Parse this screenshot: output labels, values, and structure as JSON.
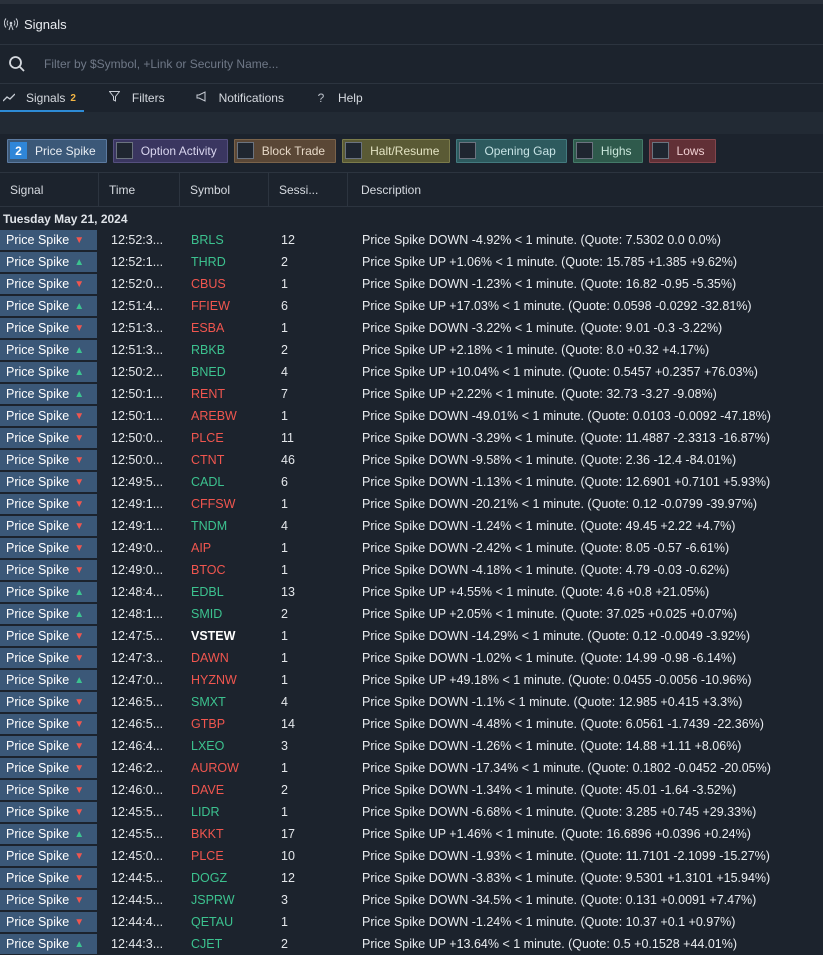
{
  "window": {
    "title": "Signals",
    "title_icon": "broadcast-icon"
  },
  "search": {
    "placeholder": "Filter by $Symbol, +Link or Security Name..."
  },
  "tabs": [
    {
      "label": "Signals",
      "badge": "2",
      "icon": "chart-line-icon"
    },
    {
      "label": "Filters",
      "icon": "funnel-icon"
    },
    {
      "label": "Notifications",
      "icon": "megaphone-icon"
    },
    {
      "label": "Help",
      "icon": "question-icon"
    }
  ],
  "chips": [
    {
      "label": "Price Spike",
      "badge": "2",
      "bg": "#3b5878",
      "border": "#5c7aa0",
      "text": "#e8edf3"
    },
    {
      "label": "Option Activity",
      "bg": "#3a3660",
      "border": "#55507f",
      "text": "#d9d6ef"
    },
    {
      "label": "Block Trade",
      "bg": "#5a4736",
      "border": "#7a634b",
      "text": "#e6d8c7"
    },
    {
      "label": "Halt/Resume",
      "bg": "#5a5a35",
      "border": "#7b7b4b",
      "text": "#e3e3c2"
    },
    {
      "label": "Opening Gap",
      "bg": "#2d5a5e",
      "border": "#437a7f",
      "text": "#c7e3e5"
    },
    {
      "label": "Highs",
      "bg": "#2f5a4c",
      "border": "#447a69",
      "text": "#c9e6da"
    },
    {
      "label": "Lows",
      "bg": "#613036",
      "border": "#83464d",
      "text": "#f0cfd2"
    }
  ],
  "columns": {
    "signal": "Signal",
    "time": "Time",
    "symbol": "Symbol",
    "session": "Sessi...",
    "description": "Description"
  },
  "date_group": "Tuesday May 21, 2024",
  "rows": [
    {
      "signal": "Price Spike",
      "dir": "down",
      "time": "12:52:3...",
      "symbol": "BRLS",
      "sym_color": "up",
      "session": "12",
      "desc": "Price Spike DOWN -4.92% < 1 minute. (Quote: 7.5302 0.0 0.0%)"
    },
    {
      "signal": "Price Spike",
      "dir": "up",
      "time": "12:52:1...",
      "symbol": "THRD",
      "sym_color": "up",
      "session": "2",
      "desc": "Price Spike UP +1.06% < 1 minute. (Quote: 15.785 +1.385 +9.62%)"
    },
    {
      "signal": "Price Spike",
      "dir": "down",
      "time": "12:52:0...",
      "symbol": "CBUS",
      "sym_color": "down",
      "session": "1",
      "desc": "Price Spike DOWN -1.23% < 1 minute. (Quote: 16.82 -0.95 -5.35%)"
    },
    {
      "signal": "Price Spike",
      "dir": "up",
      "time": "12:51:4...",
      "symbol": "FFIEW",
      "sym_color": "down",
      "session": "6",
      "desc": "Price Spike UP +17.03% < 1 minute. (Quote: 0.0598 -0.0292 -32.81%)"
    },
    {
      "signal": "Price Spike",
      "dir": "down",
      "time": "12:51:3...",
      "symbol": "ESBA",
      "sym_color": "down",
      "session": "1",
      "desc": "Price Spike DOWN -3.22% < 1 minute. (Quote: 9.01 -0.3 -3.22%)"
    },
    {
      "signal": "Price Spike",
      "dir": "up",
      "time": "12:51:3...",
      "symbol": "RBKB",
      "sym_color": "up",
      "session": "2",
      "desc": "Price Spike UP +2.18% < 1 minute. (Quote: 8.0 +0.32 +4.17%)"
    },
    {
      "signal": "Price Spike",
      "dir": "up",
      "time": "12:50:2...",
      "symbol": "BNED",
      "sym_color": "up",
      "session": "4",
      "desc": "Price Spike UP +10.04% < 1 minute. (Quote: 0.5457 +0.2357 +76.03%)"
    },
    {
      "signal": "Price Spike",
      "dir": "up",
      "time": "12:50:1...",
      "symbol": "RENT",
      "sym_color": "down",
      "session": "7",
      "desc": "Price Spike UP +2.22% < 1 minute. (Quote: 32.73 -3.27 -9.08%)"
    },
    {
      "signal": "Price Spike",
      "dir": "down",
      "time": "12:50:1...",
      "symbol": "AREBW",
      "sym_color": "down",
      "session": "1",
      "desc": "Price Spike DOWN -49.01% < 1 minute. (Quote: 0.0103 -0.0092 -47.18%)"
    },
    {
      "signal": "Price Spike",
      "dir": "down",
      "time": "12:50:0...",
      "symbol": "PLCE",
      "sym_color": "down",
      "session": "11",
      "desc": "Price Spike DOWN -3.29% < 1 minute. (Quote: 11.4887 -2.3313 -16.87%)"
    },
    {
      "signal": "Price Spike",
      "dir": "down",
      "time": "12:50:0...",
      "symbol": "CTNT",
      "sym_color": "down",
      "session": "46",
      "desc": "Price Spike DOWN -9.58% < 1 minute. (Quote: 2.36 -12.4 -84.01%)"
    },
    {
      "signal": "Price Spike",
      "dir": "down",
      "time": "12:49:5...",
      "symbol": "CADL",
      "sym_color": "up",
      "session": "6",
      "desc": "Price Spike DOWN -1.13% < 1 minute. (Quote: 12.6901 +0.7101 +5.93%)"
    },
    {
      "signal": "Price Spike",
      "dir": "down",
      "time": "12:49:1...",
      "symbol": "CFFSW",
      "sym_color": "down",
      "session": "1",
      "desc": "Price Spike DOWN -20.21% < 1 minute. (Quote: 0.12 -0.0799 -39.97%)"
    },
    {
      "signal": "Price Spike",
      "dir": "down",
      "time": "12:49:1...",
      "symbol": "TNDM",
      "sym_color": "up",
      "session": "4",
      "desc": "Price Spike DOWN -1.24% < 1 minute. (Quote: 49.45 +2.22 +4.7%)"
    },
    {
      "signal": "Price Spike",
      "dir": "down",
      "time": "12:49:0...",
      "symbol": "AIP",
      "sym_color": "down",
      "session": "1",
      "desc": "Price Spike DOWN -2.42% < 1 minute. (Quote: 8.05 -0.57 -6.61%)"
    },
    {
      "signal": "Price Spike",
      "dir": "down",
      "time": "12:49:0...",
      "symbol": "BTOC",
      "sym_color": "down",
      "session": "1",
      "desc": "Price Spike DOWN -4.18% < 1 minute. (Quote: 4.79 -0.03 -0.62%)"
    },
    {
      "signal": "Price Spike",
      "dir": "up",
      "time": "12:48:4...",
      "symbol": "EDBL",
      "sym_color": "up",
      "session": "13",
      "desc": "Price Spike UP +4.55% < 1 minute. (Quote: 4.6 +0.8 +21.05%)"
    },
    {
      "signal": "Price Spike",
      "dir": "up",
      "time": "12:48:1...",
      "symbol": "SMID",
      "sym_color": "up",
      "session": "2",
      "desc": "Price Spike UP +2.05% < 1 minute. (Quote: 37.025 +0.025 +0.07%)"
    },
    {
      "signal": "Price Spike",
      "dir": "down",
      "time": "12:47:5...",
      "symbol": "VSTEW",
      "sym_color": "white",
      "session": "1",
      "desc": "Price Spike DOWN -14.29% < 1 minute. (Quote: 0.12 -0.0049 -3.92%)"
    },
    {
      "signal": "Price Spike",
      "dir": "down",
      "time": "12:47:3...",
      "symbol": "DAWN",
      "sym_color": "down",
      "session": "1",
      "desc": "Price Spike DOWN -1.02% < 1 minute. (Quote: 14.99 -0.98 -6.14%)"
    },
    {
      "signal": "Price Spike",
      "dir": "up",
      "time": "12:47:0...",
      "symbol": "HYZNW",
      "sym_color": "down",
      "session": "1",
      "desc": "Price Spike UP +49.18% < 1 minute. (Quote: 0.0455 -0.0056 -10.96%)"
    },
    {
      "signal": "Price Spike",
      "dir": "down",
      "time": "12:46:5...",
      "symbol": "SMXT",
      "sym_color": "up",
      "session": "4",
      "desc": "Price Spike DOWN -1.1% < 1 minute. (Quote: 12.985 +0.415 +3.3%)"
    },
    {
      "signal": "Price Spike",
      "dir": "down",
      "time": "12:46:5...",
      "symbol": "GTBP",
      "sym_color": "down",
      "session": "14",
      "desc": "Price Spike DOWN -4.48% < 1 minute. (Quote: 6.0561 -1.7439 -22.36%)"
    },
    {
      "signal": "Price Spike",
      "dir": "down",
      "time": "12:46:4...",
      "symbol": "LXEO",
      "sym_color": "up",
      "session": "3",
      "desc": "Price Spike DOWN -1.26% < 1 minute. (Quote: 14.88 +1.11 +8.06%)"
    },
    {
      "signal": "Price Spike",
      "dir": "down",
      "time": "12:46:2...",
      "symbol": "AUROW",
      "sym_color": "down",
      "session": "1",
      "desc": "Price Spike DOWN -17.34% < 1 minute. (Quote: 0.1802 -0.0452 -20.05%)"
    },
    {
      "signal": "Price Spike",
      "dir": "down",
      "time": "12:46:0...",
      "symbol": "DAVE",
      "sym_color": "down",
      "session": "2",
      "desc": "Price Spike DOWN -1.34% < 1 minute. (Quote: 45.01 -1.64 -3.52%)"
    },
    {
      "signal": "Price Spike",
      "dir": "down",
      "time": "12:45:5...",
      "symbol": "LIDR",
      "sym_color": "up",
      "session": "1",
      "desc": "Price Spike DOWN -6.68% < 1 minute. (Quote: 3.285 +0.745 +29.33%)"
    },
    {
      "signal": "Price Spike",
      "dir": "up",
      "time": "12:45:5...",
      "symbol": "BKKT",
      "sym_color": "down",
      "session": "17",
      "desc": "Price Spike UP +1.46% < 1 minute. (Quote: 16.6896 +0.0396 +0.24%)"
    },
    {
      "signal": "Price Spike",
      "dir": "down",
      "time": "12:45:0...",
      "symbol": "PLCE",
      "sym_color": "down",
      "session": "10",
      "desc": "Price Spike DOWN -1.93% < 1 minute. (Quote: 11.7101 -2.1099 -15.27%)"
    },
    {
      "signal": "Price Spike",
      "dir": "down",
      "time": "12:44:5...",
      "symbol": "DOGZ",
      "sym_color": "up",
      "session": "12",
      "desc": "Price Spike DOWN -3.83% < 1 minute. (Quote: 9.5301 +1.3101 +15.94%)"
    },
    {
      "signal": "Price Spike",
      "dir": "down",
      "time": "12:44:5...",
      "symbol": "JSPRW",
      "sym_color": "up",
      "session": "3",
      "desc": "Price Spike DOWN -34.5% < 1 minute. (Quote: 0.131 +0.0091 +7.47%)"
    },
    {
      "signal": "Price Spike",
      "dir": "down",
      "time": "12:44:4...",
      "symbol": "QETAU",
      "sym_color": "up",
      "session": "1",
      "desc": "Price Spike DOWN -1.24% < 1 minute. (Quote: 10.37 +0.1 +0.97%)"
    },
    {
      "signal": "Price Spike",
      "dir": "up",
      "time": "12:44:3...",
      "symbol": "CJET",
      "sym_color": "up",
      "session": "2",
      "desc": "Price Spike UP +13.64% < 1 minute. (Quote: 0.5 +0.1528 +44.01%)"
    }
  ]
}
